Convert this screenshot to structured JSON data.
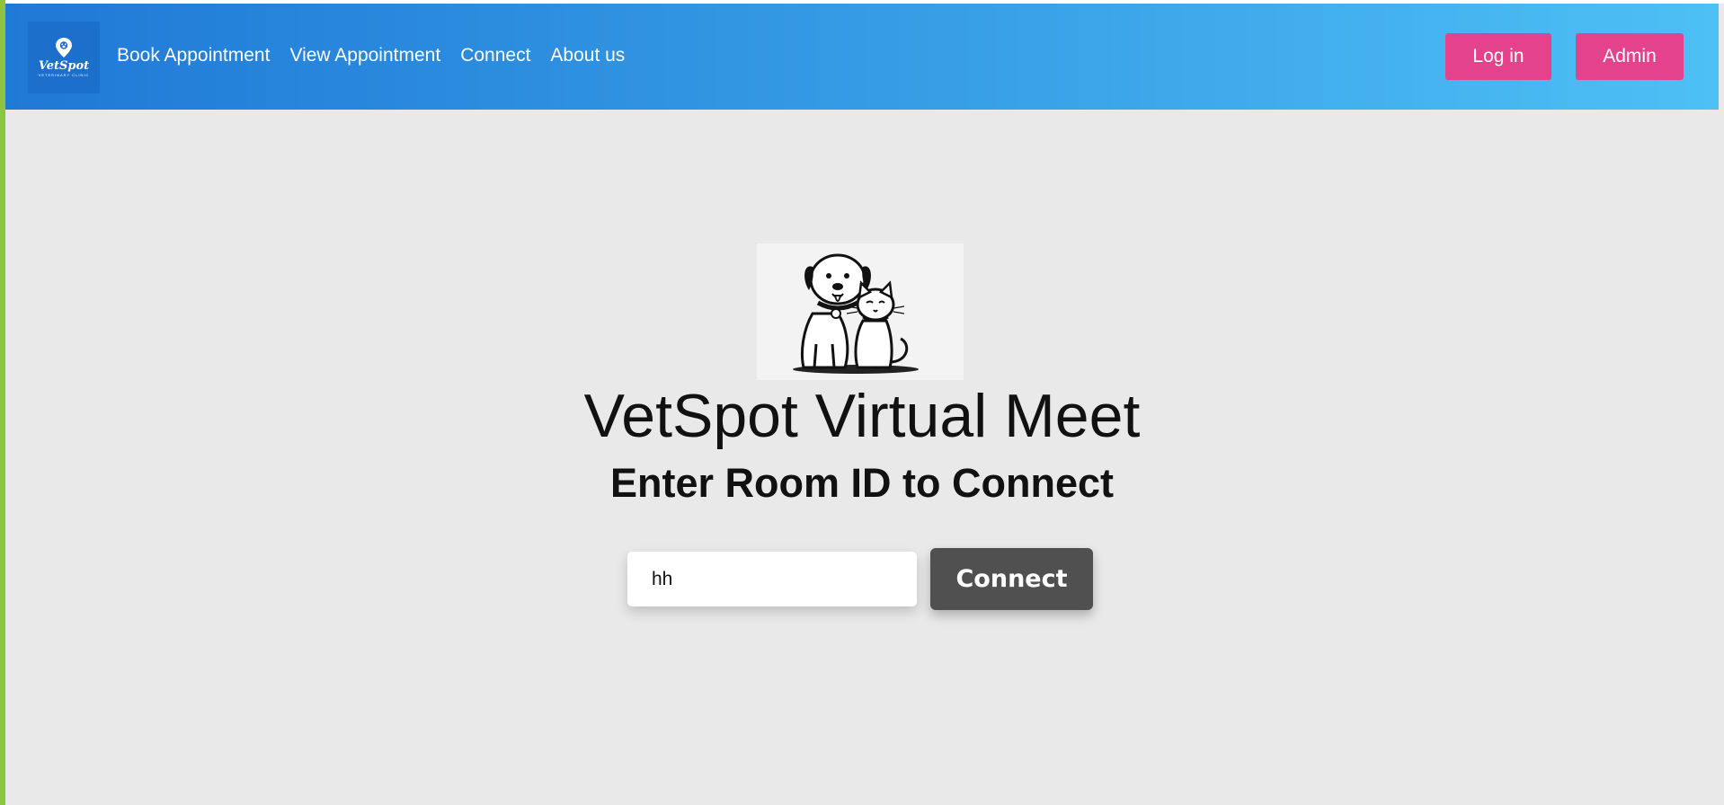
{
  "brand": {
    "logo_text": "VetSpot",
    "logo_subtext": "VETERINARY CLINIC",
    "colors": {
      "nav_start": "#1f79d6",
      "nav_end": "#4dc0f5",
      "accent_pink": "#e5428e",
      "connect_button": "#505050",
      "page_background": "#e9e9e9"
    }
  },
  "nav": {
    "links": [
      {
        "label": "Book Appointment"
      },
      {
        "label": "View Appointment"
      },
      {
        "label": "Connect"
      },
      {
        "label": "About us"
      }
    ],
    "login_label": "Log in",
    "admin_label": "Admin"
  },
  "main": {
    "hero_image_icon": "dog-and-cat-illustration",
    "title": "VetSpot Virtual Meet",
    "subtitle": "Enter Room ID to Connect",
    "room_input": {
      "value": "hh",
      "placeholder": ""
    },
    "connect_label": "Connect"
  }
}
